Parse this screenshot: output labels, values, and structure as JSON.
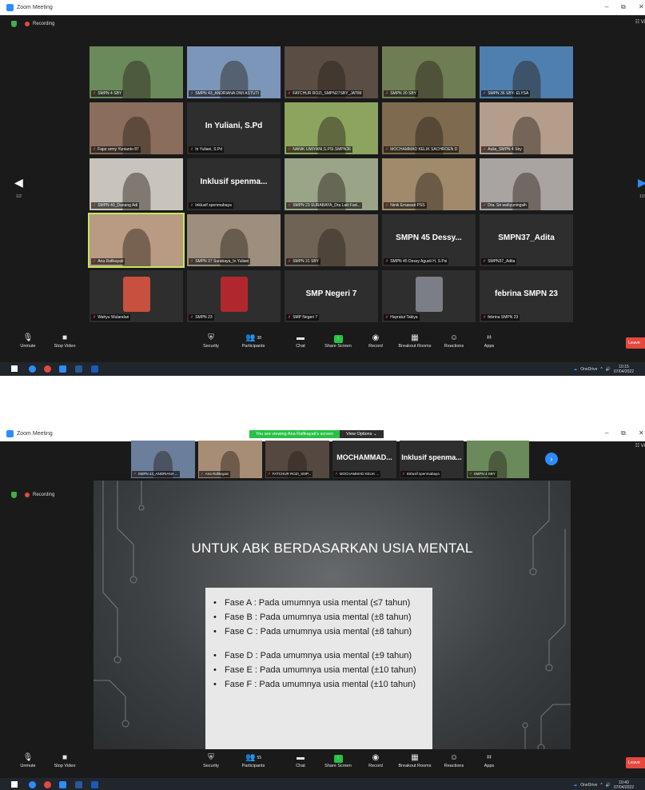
{
  "colors": {
    "zoom_blue": "#2d8cff",
    "recording_red": "#e5483f",
    "share_green": "#27c144",
    "speaker_highlight": "#c5e65a",
    "leave_red": "#e5483f"
  },
  "screenshot1": {
    "window_title": "Zoom Meeting",
    "recording": "Recording",
    "view_label": "Vi",
    "page_indicator_left": "1/2",
    "page_indicator_right": "1/2",
    "tiles": [
      {
        "name": "SMPN 4 SBY",
        "kind": "video",
        "bg": "#6b8a5b"
      },
      {
        "name": "SMPN 43_ANDRIANA DWI ASTUTI",
        "kind": "video",
        "bg": "#7b96b8"
      },
      {
        "name": "FATCHUR ROZI_SMPN27SBY_JATIM",
        "kind": "video",
        "bg": "#5a4d44"
      },
      {
        "name": "SMPN 30 SBY",
        "kind": "video",
        "bg": "#6f7d55"
      },
      {
        "name": "SMPN 36 SBY- ELYSA",
        "kind": "video",
        "bg": "#4f7fae"
      },
      {
        "name": "Fajar army Yunianto 87",
        "kind": "video",
        "bg": "#8b6d5c"
      },
      {
        "name": "In Yuliani, S.Pd",
        "kind": "name",
        "big": "In Yuliani, S.Pd"
      },
      {
        "name": "NANIK UMIYANI,S.PSI.SMPN36",
        "kind": "video",
        "bg": "#8da45e"
      },
      {
        "name": "MOCHAMMAD KELIK SACHROEN D",
        "kind": "video",
        "bg": "#7e6b4f"
      },
      {
        "name": "Aulia_SMPN 4 Sby",
        "kind": "video",
        "bg": "#b59d8c"
      },
      {
        "name": "SMPN 40_Danang Adi",
        "kind": "video",
        "bg": "#c9c4bb"
      },
      {
        "name": "Inklusif spenmabaya",
        "kind": "name",
        "big": "Inklusif spenma..."
      },
      {
        "name": "SMPN 23 SURABAYA_Dra Laili Fad...",
        "kind": "video",
        "bg": "#9aa487"
      },
      {
        "name": "Ninik Ernawati PSS",
        "kind": "video",
        "bg": "#a08a6c"
      },
      {
        "name": "Dra. Sri wahyuningsih",
        "kind": "video",
        "bg": "#a9a4a1"
      },
      {
        "name": "Ana Rafikayati",
        "kind": "video",
        "bg": "#b99a82",
        "speaking": true
      },
      {
        "name": "SMPN 37 Surabaya_In Yuliani",
        "kind": "video",
        "bg": "#9d8e7d"
      },
      {
        "name": "SMPN 31 SBY",
        "kind": "video",
        "bg": "#6f6356"
      },
      {
        "name": "SMPN 45 Dessy Agusti H, S.Psi",
        "kind": "name",
        "big": "SMPN 45 Dessy..."
      },
      {
        "name": "SMPN37_Adita",
        "kind": "name",
        "big": "SMPN37_Adita"
      },
      {
        "name": "Wahyu Wulandari",
        "kind": "video",
        "bg": "#2e2e2e",
        "portrait": "#c8503e"
      },
      {
        "name": "SMPN 23",
        "kind": "video",
        "bg": "#2e2e2e",
        "portrait": "#b0282e"
      },
      {
        "name": "SMP Negeri 7",
        "kind": "name",
        "big": "SMP Negeri 7"
      },
      {
        "name": "Hayratut Takiya",
        "kind": "video",
        "bg": "#2e2e2e",
        "portrait": "#7b7e86"
      },
      {
        "name": "febrina SMPN 23",
        "kind": "name",
        "big": "febrina SMPN 23"
      }
    ],
    "participants_count": "38",
    "leave": "Leave",
    "time": "10:15",
    "date": "07/04/2022"
  },
  "screenshot2": {
    "window_title": "Zoom Meeting",
    "viewing_banner": "You are viewing Ana Rafikayati's screen",
    "view_options": "View Options",
    "recording": "Recording",
    "view_label": "Vi",
    "strip": [
      {
        "name": "SMPN 43_ANDRIANA ...",
        "kind": "video",
        "bg": "#6b7f9c"
      },
      {
        "name": "Ana Rafikayati",
        "kind": "video",
        "bg": "#a88d76"
      },
      {
        "name": "FATCHUR ROZI_SMP...",
        "kind": "video",
        "bg": "#544840"
      },
      {
        "name": "MOCHAMMAD KELIK ...",
        "kind": "name",
        "big": "MOCHAMMAD..."
      },
      {
        "name": "Inklusif spenmabaya",
        "kind": "name",
        "big": "Inklusif spenma..."
      },
      {
        "name": "SMPN 4 SBY",
        "kind": "video",
        "bg": "#6b8a5b"
      }
    ],
    "slide": {
      "title": "UNTUK ABK BERDASARKAN USIA MENTAL",
      "bullets_a": [
        "Fase A : Pada umumnya usia mental (≤7 tahun)",
        "Fase B : Pada umumnya usia mental (±8 tahun)",
        "Fase C : Pada umumnya usia mental (±8 tahun)"
      ],
      "bullets_b": [
        "Fase D : Pada umumnya usia mental (±9 tahun)",
        "Fase E : Pada umumnya usia mental (±10 tahun)",
        "Fase F : Pada umumnya usia mental (±10 tahun)"
      ]
    },
    "participants_count": "55",
    "leave": "Leave",
    "time": "10:40",
    "date": "07/04/2022"
  },
  "toolbar": {
    "unmute": "Unmute",
    "stop_video": "Stop Video",
    "security": "Security",
    "participants": "Participants",
    "chat": "Chat",
    "share_screen": "Share Screen",
    "record": "Record",
    "breakout_rooms": "Breakout Rooms",
    "reactions": "Reactions",
    "apps": "Apps"
  },
  "tray": {
    "onedrive": "OneDrive"
  }
}
